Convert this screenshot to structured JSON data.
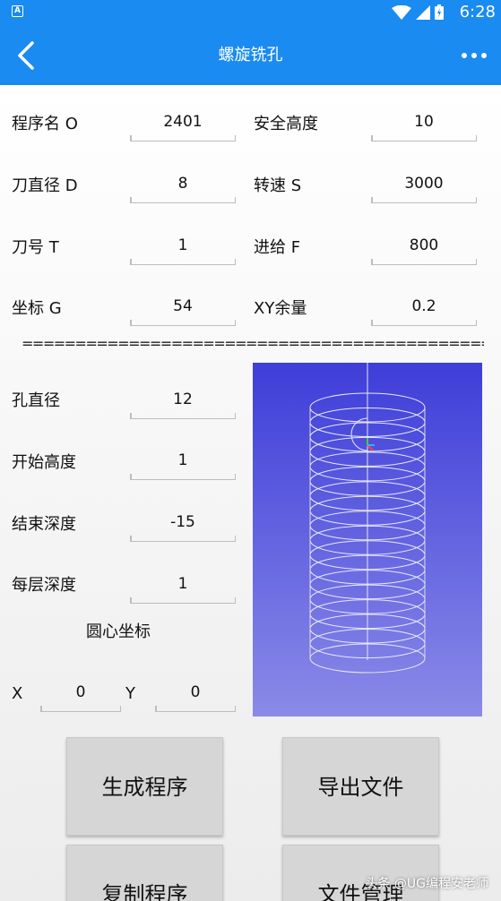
{
  "status": {
    "app_badge": "A",
    "time": "6:28"
  },
  "header": {
    "title": "螺旋铣孔"
  },
  "params": {
    "program_name": {
      "label": "程序名 O",
      "value": "2401"
    },
    "safe_height": {
      "label": "安全高度",
      "value": "10"
    },
    "tool_diameter": {
      "label": "刀直径 D",
      "value": "8"
    },
    "spindle_speed": {
      "label": "转速 S",
      "value": "3000"
    },
    "tool_number": {
      "label": "刀号 T",
      "value": "1"
    },
    "feed": {
      "label": "进给 F",
      "value": "800"
    },
    "coordinate": {
      "label": "坐标 G",
      "value": "54"
    },
    "xy_allowance": {
      "label": "XY余量",
      "value": "0.2"
    }
  },
  "divider": "================================================",
  "hole": {
    "diameter": {
      "label": "孔直径",
      "value": "12"
    },
    "start_height": {
      "label": "开始高度",
      "value": "1"
    },
    "end_depth": {
      "label": "结束深度",
      "value": "-15"
    },
    "step_depth": {
      "label": "每层深度",
      "value": "1"
    },
    "center_title": "圆心坐标",
    "center_x": {
      "label": "X",
      "value": "0"
    },
    "center_y": {
      "label": "Y",
      "value": "0"
    }
  },
  "actions": {
    "generate": "生成程序",
    "export": "导出文件",
    "copy": "复制程序",
    "file_manager": "文件管理"
  },
  "watermark": "头条 @UG编程安老师",
  "colors": {
    "appbar": "#1a8bf0",
    "preview_top": "#3e3ed9",
    "preview_bottom": "#8a8ae8",
    "button": "#d6d6d6"
  }
}
